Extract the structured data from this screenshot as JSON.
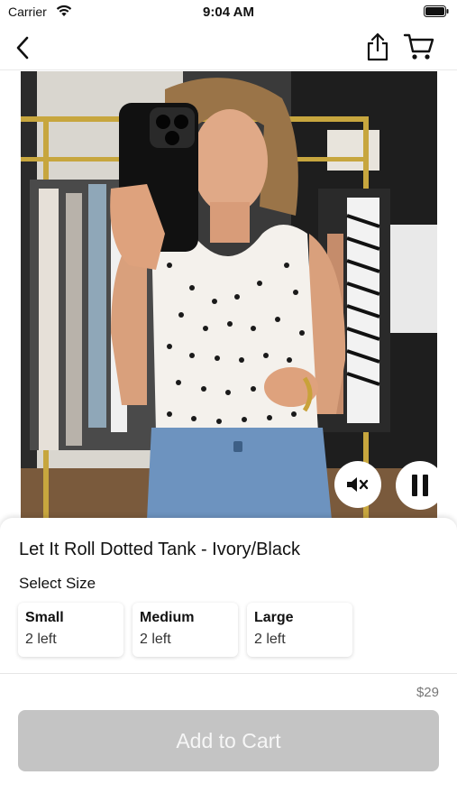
{
  "status_bar": {
    "carrier": "Carrier",
    "time": "9:04 AM"
  },
  "nav": {
    "back_icon": "chevron-left-icon",
    "share_icon": "share-icon",
    "cart_icon": "shopping-cart-icon"
  },
  "video": {
    "mute_icon": "speaker-muted-icon",
    "pause_icon": "pause-icon"
  },
  "product": {
    "title": "Let It Roll Dotted Tank - Ivory/Black",
    "size_heading": "Select Size",
    "sizes": [
      {
        "name": "Small",
        "stock": "2 left"
      },
      {
        "name": "Medium",
        "stock": "2 left"
      },
      {
        "name": "Large",
        "stock": "2 left"
      }
    ],
    "price": "$29",
    "add_to_cart_label": "Add to Cart"
  },
  "colors": {
    "button_disabled": "#c4c4c4",
    "price_text": "#777777"
  }
}
